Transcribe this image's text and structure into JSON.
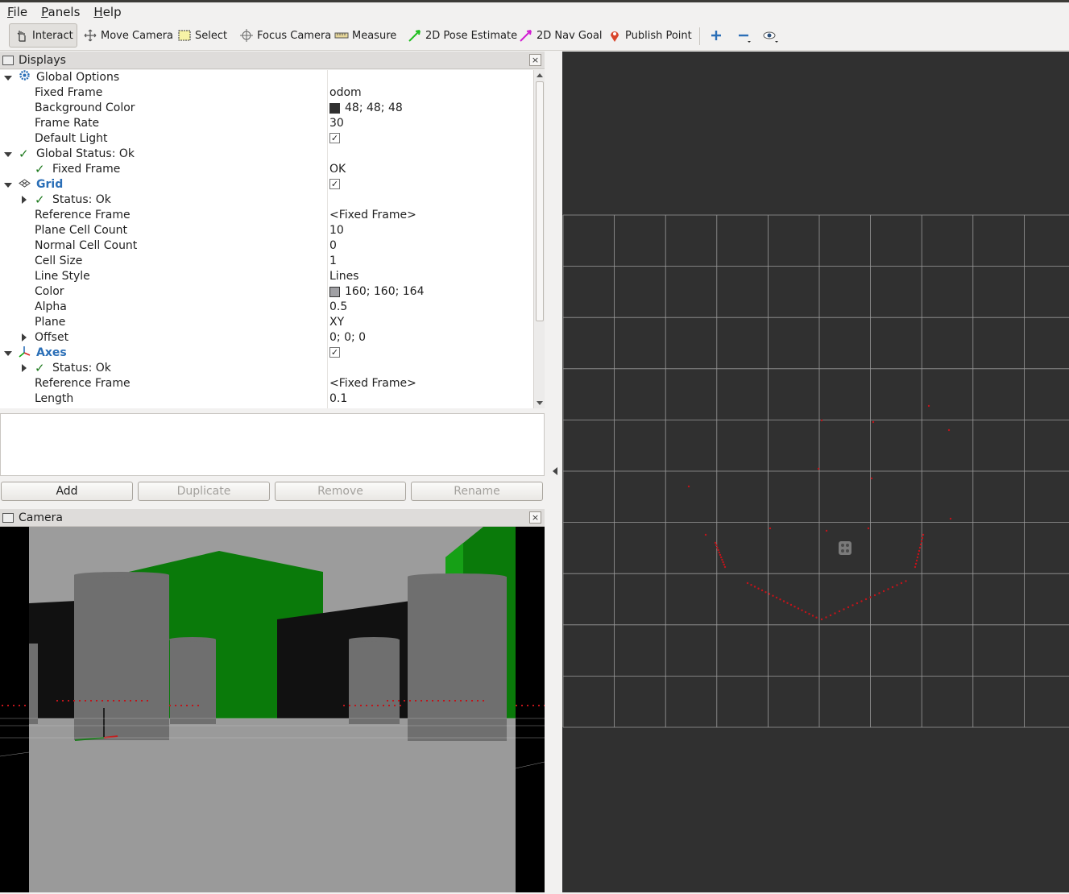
{
  "menubar": {
    "items": [
      {
        "label": "File",
        "accel": "F",
        "rest": "ile"
      },
      {
        "label": "Panels",
        "accel": "P",
        "rest": "anels"
      },
      {
        "label": "Help",
        "accel": "H",
        "rest": "elp"
      }
    ]
  },
  "toolbar": {
    "interact": "Interact",
    "move_camera": "Move Camera",
    "select": "Select",
    "focus_camera": "Focus Camera",
    "measure": "Measure",
    "pose_estimate": "2D Pose Estimate",
    "nav_goal": "2D Nav Goal",
    "publish_point": "Publish Point"
  },
  "displays": {
    "title": "Displays",
    "close": "×",
    "global_options": {
      "label": "Global Options",
      "fixed_frame_label": "Fixed Frame",
      "fixed_frame": "odom",
      "bg_color_label": "Background Color",
      "bg_color": "48; 48; 48",
      "bg_swatch": "#303030",
      "frame_rate_label": "Frame Rate",
      "frame_rate": "30",
      "default_light_label": "Default Light",
      "default_light": "✓"
    },
    "global_status": {
      "label": "Global Status: Ok",
      "fixed_frame_label": "Fixed Frame",
      "fixed_frame": "OK"
    },
    "grid": {
      "label": "Grid",
      "enabled": "✓",
      "status_label": "Status: Ok",
      "ref_frame_label": "Reference Frame",
      "ref_frame": "<Fixed Frame>",
      "plane_cell_count_label": "Plane Cell Count",
      "plane_cell_count": "10",
      "normal_cell_count_label": "Normal Cell Count",
      "normal_cell_count": "0",
      "cell_size_label": "Cell Size",
      "cell_size": "1",
      "line_style_label": "Line Style",
      "line_style": "Lines",
      "color_label": "Color",
      "color": "160; 160; 164",
      "color_swatch": "#a0a0a4",
      "alpha_label": "Alpha",
      "alpha": "0.5",
      "plane_label": "Plane",
      "plane": "XY",
      "offset_label": "Offset",
      "offset": "0; 0; 0"
    },
    "axes": {
      "label": "Axes",
      "enabled": "✓",
      "status_label": "Status: Ok",
      "ref_frame_label": "Reference Frame",
      "ref_frame": "<Fixed Frame>",
      "length_label": "Length",
      "length": "0.1"
    },
    "buttons": {
      "add": "Add",
      "duplicate": "Duplicate",
      "remove": "Remove",
      "rename": "Rename"
    }
  },
  "camera_panel": {
    "title": "Camera",
    "close": "×"
  },
  "colors": {
    "grid_line": "#9a9a9a",
    "scan_point": "#c0141a",
    "view_bg": "#303030"
  }
}
